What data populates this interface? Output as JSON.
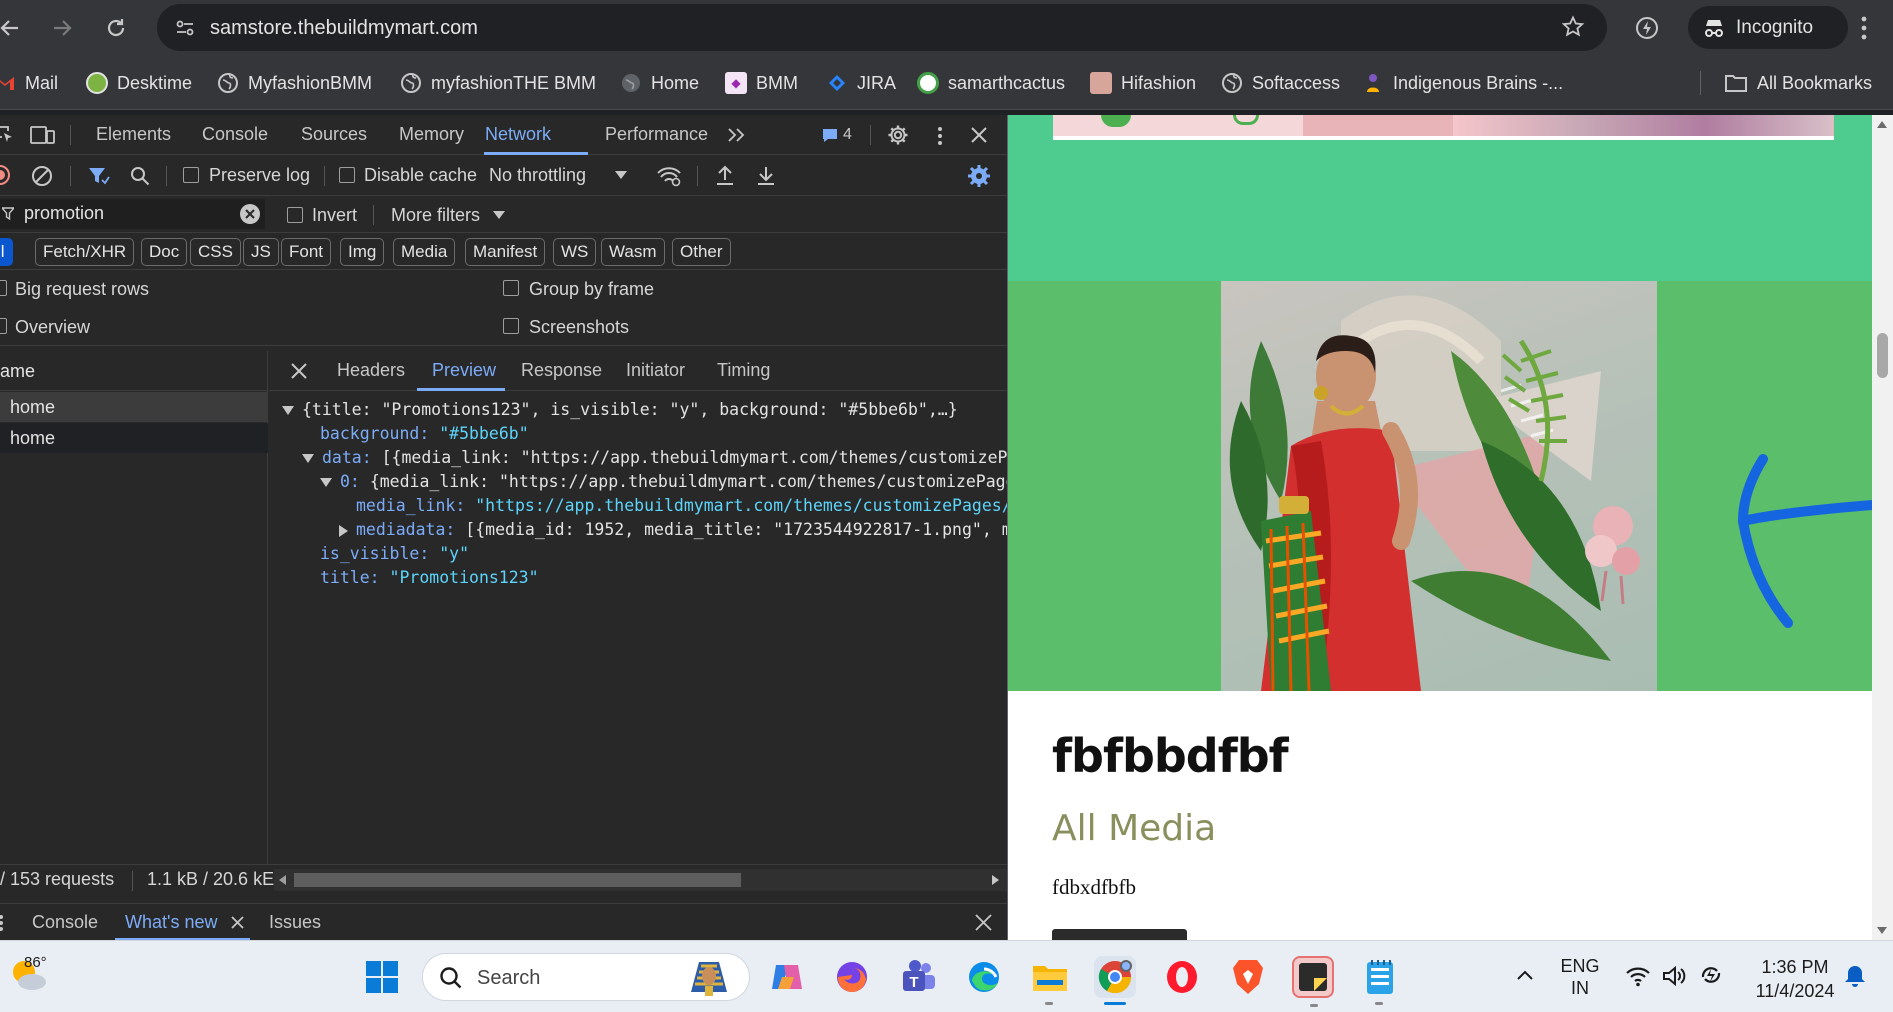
{
  "browser": {
    "url": "samstore.thebuildmymart.com",
    "profile_label": "Incognito",
    "all_bookmarks_label": "All Bookmarks",
    "bookmarks": [
      {
        "label": "Mail",
        "icon": "gmail-icon",
        "color": "#ea4335"
      },
      {
        "label": "Desktime",
        "icon": "desktime-icon",
        "color": "#7cb342"
      },
      {
        "label": "MyfashionBMM",
        "icon": "globe-icon",
        "color": "#9aa0a6"
      },
      {
        "label": "myfashionTHE BMM",
        "icon": "globe-icon",
        "color": "#9aa0a6"
      },
      {
        "label": "Home",
        "icon": "globe-icon",
        "color": "#5f6368"
      },
      {
        "label": "BMM",
        "icon": "bmm-icon",
        "color": "#9c27b0"
      },
      {
        "label": "JIRA",
        "icon": "jira-icon",
        "color": "#2684ff"
      },
      {
        "label": "samarthcactus",
        "icon": "cactus-icon",
        "color": "#43a047"
      },
      {
        "label": "Hifashion",
        "icon": "hifashion-icon",
        "color": "#d7a59a"
      },
      {
        "label": "Softaccess",
        "icon": "globe-icon",
        "color": "#9aa0a6"
      },
      {
        "label": "Indigenous Brains -...",
        "icon": "indigenous-icon",
        "color": "#7e57c2"
      }
    ]
  },
  "devtools": {
    "tabs": [
      "Elements",
      "Console",
      "Sources",
      "Memory",
      "Network",
      "Performance"
    ],
    "active_tab": "Network",
    "issues_count": "4",
    "toolbar": {
      "preserve_log": "Preserve log",
      "disable_cache": "Disable cache",
      "throttling": "No throttling"
    },
    "filter": {
      "value": "promotion",
      "invert": "Invert",
      "more_filters": "More filters"
    },
    "type_chips": [
      "ll",
      "Fetch/XHR",
      "Doc",
      "CSS",
      "JS",
      "Font",
      "Img",
      "Media",
      "Manifest",
      "WS",
      "Wasm",
      "Other"
    ],
    "options": {
      "big_request_rows": "Big request rows",
      "group_by_frame": "Group by frame",
      "overview": "Overview",
      "screenshots": "Screenshots"
    },
    "requests_header": "ame",
    "requests": [
      "home",
      "home"
    ],
    "detail_tabs": [
      "Headers",
      "Preview",
      "Response",
      "Initiator",
      "Timing"
    ],
    "active_detail_tab": "Preview",
    "preview": {
      "line1": "{title: \"Promotions123\", is_visible: \"y\", background: \"#5bbe6b\",…}",
      "bg_key": "background:",
      "bg_val": "\"#5bbe6b\"",
      "data_key": "data:",
      "data_val": "[{media_link: \"https://app.thebuildmymart.com/themes/customizePa",
      "item0_key": "0:",
      "item0_val": "{media_link: \"https://app.thebuildmymart.com/themes/customizePage",
      "media_link_key": "media_link:",
      "media_link_val": "\"https://app.thebuildmymart.com/themes/customizePages/",
      "mediadata_key": "mediadata:",
      "mediadata_val": "[{media_id: 1952, media_title: \"1723544922817-1.png\", m",
      "visible_key": "is_visible:",
      "visible_val": "\"y\"",
      "title_key": "title:",
      "title_val": "\"Promotions123\""
    },
    "status": {
      "requests": "/ 153 requests",
      "transfer": "1.1 kB / 20.6 kE"
    },
    "drawer_tabs": [
      "Console",
      "What's new",
      "Issues"
    ],
    "active_drawer_tab": "What's new"
  },
  "page": {
    "band_color": "#4ecb8f",
    "promo_bg": "#5bbe6b",
    "heading": "fbfbbdfbf",
    "subheading": "All Media",
    "subheading_color": "#8a8f5e",
    "body_text": "fdbxdfbfb"
  },
  "taskbar": {
    "weather_temp": "86°",
    "search_placeholder": "Search",
    "lang_line1": "ENG",
    "lang_line2": "IN",
    "time": "1:36 PM",
    "date": "11/4/2024"
  }
}
